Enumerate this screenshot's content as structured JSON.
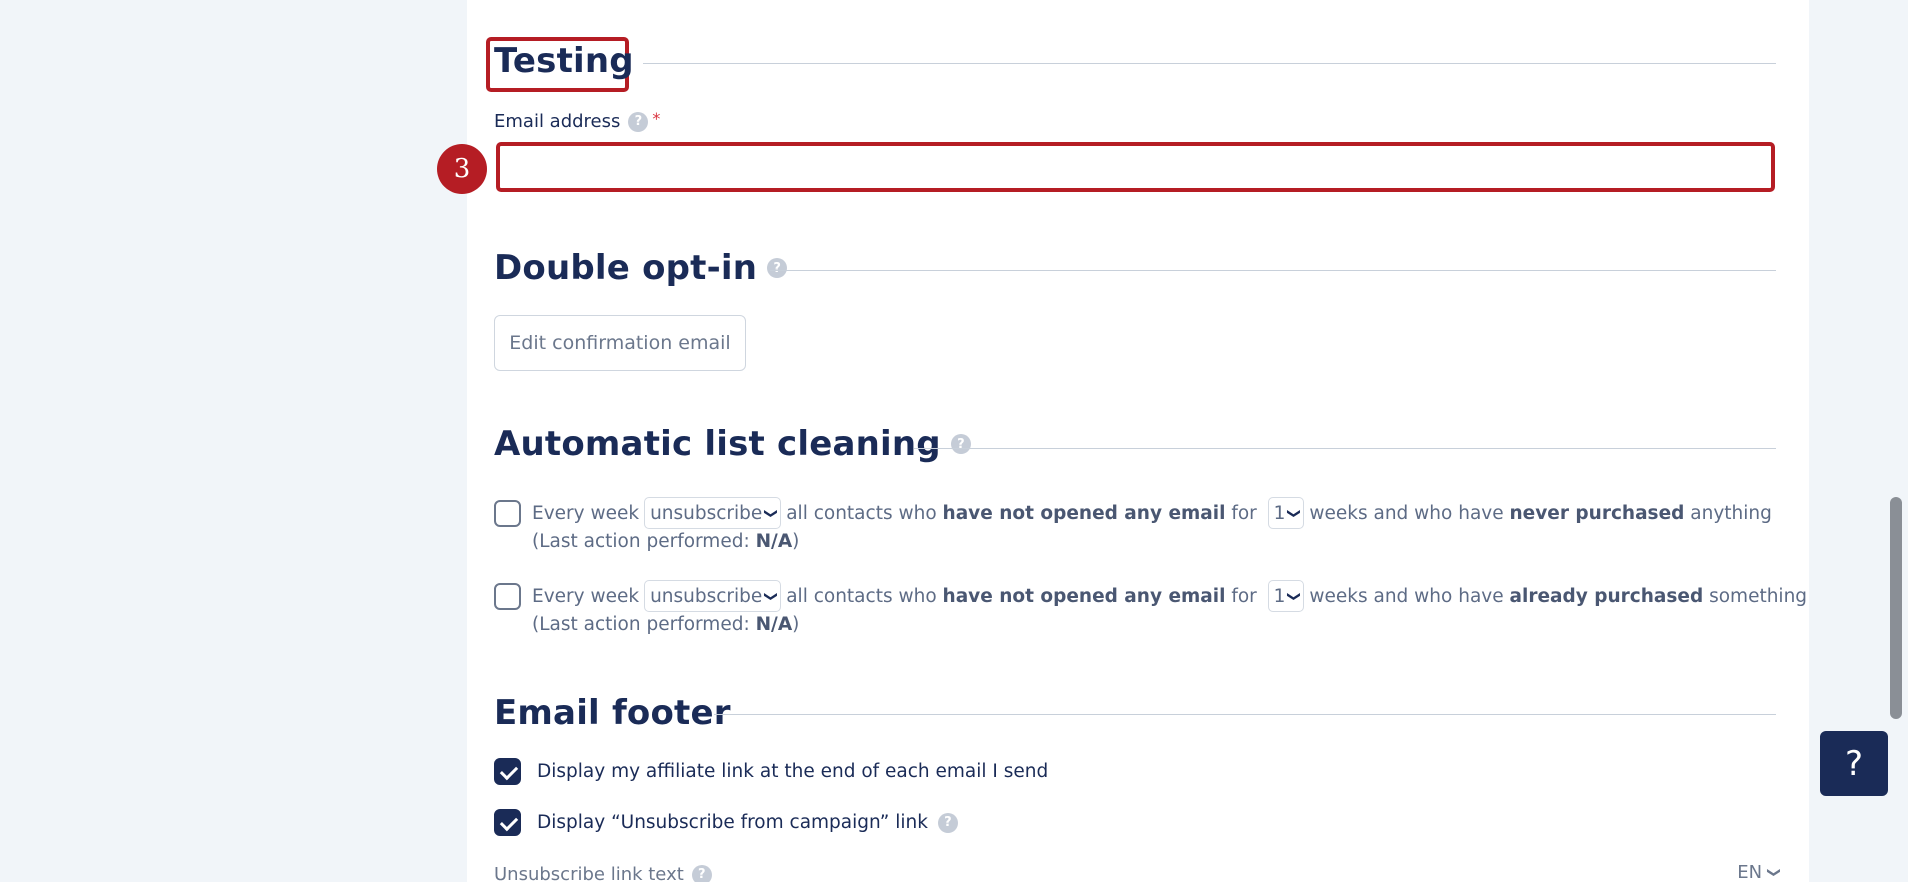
{
  "testing": {
    "title": "Testing",
    "email_label": "Email address",
    "required_mark": "*",
    "email_value": "",
    "step_badge": "3"
  },
  "double_opt_in": {
    "title": "Double opt-in",
    "edit_button": "Edit confirmation email"
  },
  "list_cleaning": {
    "title": "Automatic list cleaning",
    "rules": [
      {
        "checked": false,
        "prefix": "Every week",
        "action": "unsubscribe",
        "mid1": "all contacts who",
        "bold1": "have not opened any email",
        "mid2": "for",
        "weeks": "1",
        "mid3": "weeks and who have",
        "bold2": "never purchased",
        "suffix": "anything",
        "last_action_label": "(Last action performed:",
        "last_action_value": "N/A",
        "last_action_close": ")"
      },
      {
        "checked": false,
        "prefix": "Every week",
        "action": "unsubscribe",
        "mid1": "all contacts who",
        "bold1": "have not opened any email",
        "mid2": "for",
        "weeks": "1",
        "mid3": "weeks and who have",
        "bold2": "already purchased",
        "suffix": "something",
        "last_action_label": "(Last action performed:",
        "last_action_value": "N/A",
        "last_action_close": ")"
      }
    ]
  },
  "email_footer": {
    "title": "Email footer",
    "options": [
      {
        "checked": true,
        "label": "Display my affiliate link at the end of each email I send"
      },
      {
        "checked": true,
        "label": "Display “Unsubscribe from campaign” link"
      }
    ],
    "unsubscribe_text_label": "Unsubscribe link text",
    "language": "EN"
  },
  "help_fab": "?",
  "help_icon": "?",
  "colors": {
    "accent": "#1a2b57",
    "highlight": "#b51d24",
    "help": "#c5ccd7"
  }
}
